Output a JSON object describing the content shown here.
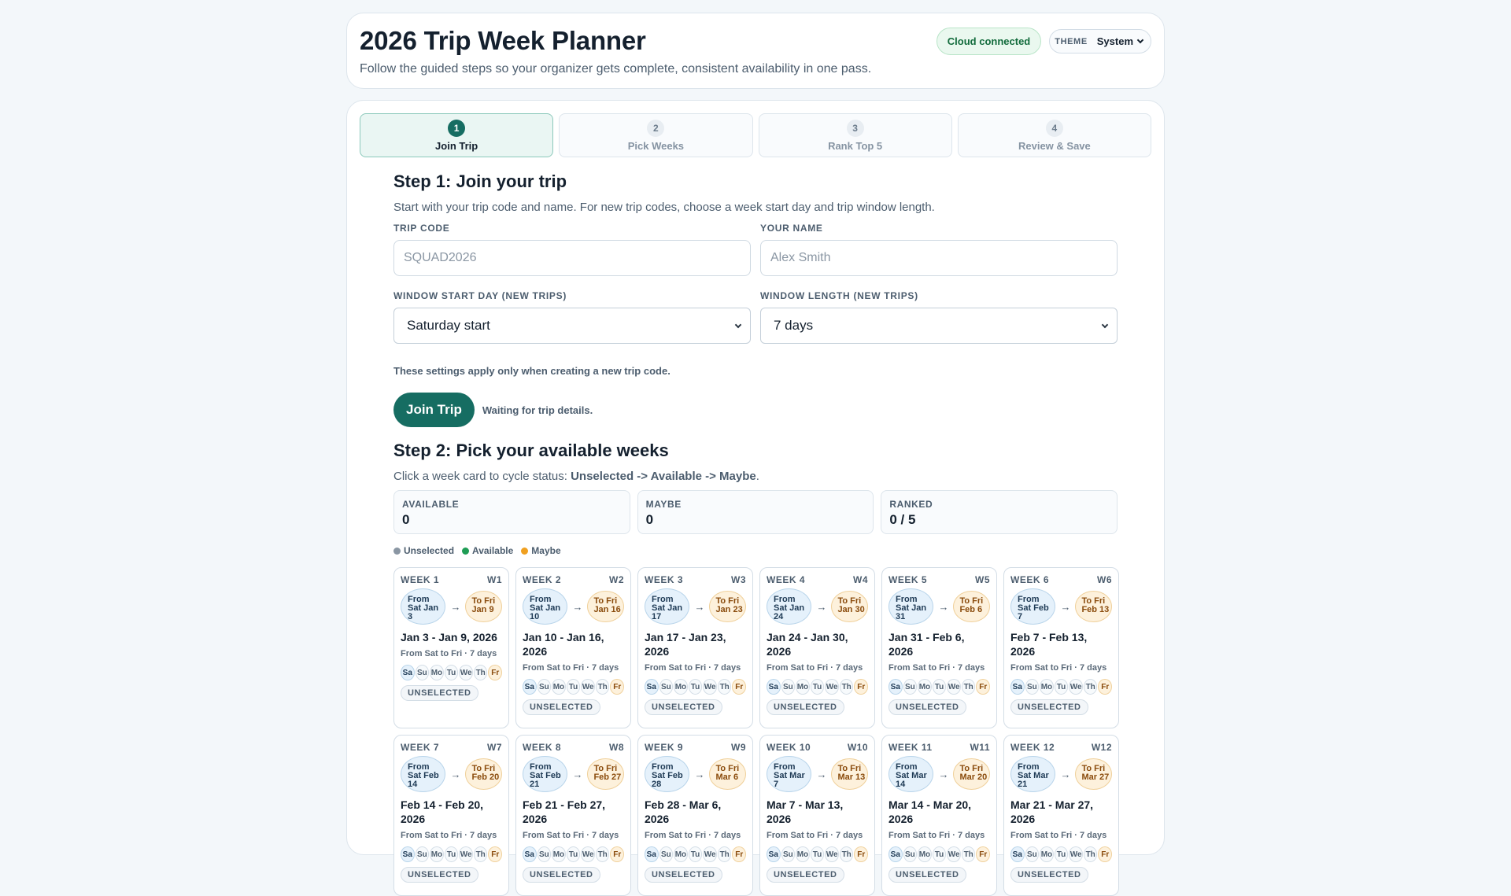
{
  "header": {
    "title": "2026 Trip Week Planner",
    "subtitle": "Follow the guided steps so your organizer gets complete, consistent availability in one pass.",
    "cloud_status": "Cloud connected",
    "theme_label": "THEME",
    "theme_value": "System"
  },
  "stepper": [
    {
      "num": "1",
      "label": "Join Trip",
      "active": true
    },
    {
      "num": "2",
      "label": "Pick Weeks",
      "active": false
    },
    {
      "num": "3",
      "label": "Rank Top 5",
      "active": false
    },
    {
      "num": "4",
      "label": "Review & Save",
      "active": false
    }
  ],
  "step1": {
    "title": "Step 1: Join your trip",
    "description": "Start with your trip code and name. For new trip codes, choose a week start day and trip window length.",
    "trip_code_label": "TRIP CODE",
    "trip_code_placeholder": "SQUAD2026",
    "name_label": "YOUR NAME",
    "name_placeholder": "Alex Smith",
    "start_day_label": "WINDOW START DAY (NEW TRIPS)",
    "start_day_value": "Saturday start",
    "length_label": "WINDOW LENGTH (NEW TRIPS)",
    "length_value": "7 days",
    "note": "These settings apply only when creating a new trip code.",
    "join_button": "Join Trip",
    "status": "Waiting for trip details."
  },
  "step2": {
    "title": "Step 2: Pick your available weeks",
    "description_prefix": "Click a week card to cycle status: ",
    "description_bold": "Unselected -> Available -> Maybe",
    "description_suffix": ".",
    "stats": [
      {
        "label": "AVAILABLE",
        "value": "0"
      },
      {
        "label": "MAYBE",
        "value": "0"
      },
      {
        "label": "RANKED",
        "value": "0 / 5"
      }
    ],
    "legend": [
      {
        "label": "Unselected",
        "color": "#8a96a3"
      },
      {
        "label": "Available",
        "color": "#1f9d55"
      },
      {
        "label": "Maybe",
        "color": "#f0a020"
      }
    ],
    "day_labels": [
      "Sa",
      "Su",
      "Mo",
      "Tu",
      "We",
      "Th",
      "Fr"
    ],
    "weeks": [
      {
        "title": "WEEK 1",
        "code": "W1",
        "from": "From Sat Jan 3",
        "to": "To Fri Jan 9",
        "range": "Jan 3 - Jan 9, 2026",
        "meta": "From Sat to Fri · 7 days",
        "status": "UNSELECTED"
      },
      {
        "title": "WEEK 2",
        "code": "W2",
        "from": "From Sat Jan 10",
        "to": "To Fri Jan 16",
        "range": "Jan 10 - Jan 16, 2026",
        "meta": "From Sat to Fri · 7 days",
        "status": "UNSELECTED"
      },
      {
        "title": "WEEK 3",
        "code": "W3",
        "from": "From Sat Jan 17",
        "to": "To Fri Jan 23",
        "range": "Jan 17 - Jan 23, 2026",
        "meta": "From Sat to Fri · 7 days",
        "status": "UNSELECTED"
      },
      {
        "title": "WEEK 4",
        "code": "W4",
        "from": "From Sat Jan 24",
        "to": "To Fri Jan 30",
        "range": "Jan 24 - Jan 30, 2026",
        "meta": "From Sat to Fri · 7 days",
        "status": "UNSELECTED"
      },
      {
        "title": "WEEK 5",
        "code": "W5",
        "from": "From Sat Jan 31",
        "to": "To Fri Feb 6",
        "range": "Jan 31 - Feb 6, 2026",
        "meta": "From Sat to Fri · 7 days",
        "status": "UNSELECTED"
      },
      {
        "title": "WEEK 6",
        "code": "W6",
        "from": "From Sat Feb 7",
        "to": "To Fri Feb 13",
        "range": "Feb 7 - Feb 13, 2026",
        "meta": "From Sat to Fri · 7 days",
        "status": "UNSELECTED"
      },
      {
        "title": "WEEK 7",
        "code": "W7",
        "from": "From Sat Feb 14",
        "to": "To Fri Feb 20",
        "range": "Feb 14 - Feb 20, 2026",
        "meta": "From Sat to Fri · 7 days",
        "status": "UNSELECTED"
      },
      {
        "title": "WEEK 8",
        "code": "W8",
        "from": "From Sat Feb 21",
        "to": "To Fri Feb 27",
        "range": "Feb 21 - Feb 27, 2026",
        "meta": "From Sat to Fri · 7 days",
        "status": "UNSELECTED"
      },
      {
        "title": "WEEK 9",
        "code": "W9",
        "from": "From Sat Feb 28",
        "to": "To Fri Mar 6",
        "range": "Feb 28 - Mar 6, 2026",
        "meta": "From Sat to Fri · 7 days",
        "status": "UNSELECTED"
      },
      {
        "title": "WEEK 10",
        "code": "W10",
        "from": "From Sat Mar 7",
        "to": "To Fri Mar 13",
        "range": "Mar 7 - Mar 13, 2026",
        "meta": "From Sat to Fri · 7 days",
        "status": "UNSELECTED"
      },
      {
        "title": "WEEK 11",
        "code": "W11",
        "from": "From Sat Mar 14",
        "to": "To Fri Mar 20",
        "range": "Mar 14 - Mar 20, 2026",
        "meta": "From Sat to Fri · 7 days",
        "status": "UNSELECTED"
      },
      {
        "title": "WEEK 12",
        "code": "W12",
        "from": "From Sat Mar 21",
        "to": "To Fri Mar 27",
        "range": "Mar 21 - Mar 27, 2026",
        "meta": "From Sat to Fri · 7 days",
        "status": "UNSELECTED"
      }
    ]
  }
}
